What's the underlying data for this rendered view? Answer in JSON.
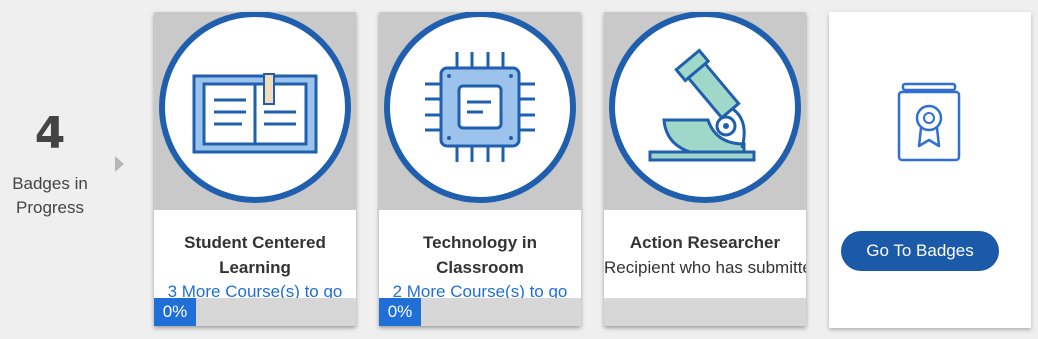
{
  "summary": {
    "count": "4",
    "label": "Badges in Progress"
  },
  "colors": {
    "accent": "#1f6fd6",
    "button": "#1a5aa8",
    "ring": "#1f5fae",
    "art_bg": "#c9c9c9"
  },
  "badges": [
    {
      "title": "Student Centered Learning",
      "description": "",
      "link": "3 More Course(s) to go",
      "progress_label": "0%",
      "progress": 0,
      "icon": "open-book-icon",
      "show_progress_label": true
    },
    {
      "title": "Technology in Classroom",
      "description": "",
      "link": "2 More Course(s) to go",
      "progress_label": "0%",
      "progress": 0,
      "icon": "microchip-icon",
      "show_progress_label": true
    },
    {
      "title": "Action Researcher",
      "description": "Recipient who has submitted",
      "link": "",
      "progress_label": "",
      "progress": 0,
      "icon": "microscope-icon",
      "show_progress_label": false
    }
  ],
  "goto": {
    "label": "Go To Badges",
    "icon": "certificate-badge-icon"
  }
}
